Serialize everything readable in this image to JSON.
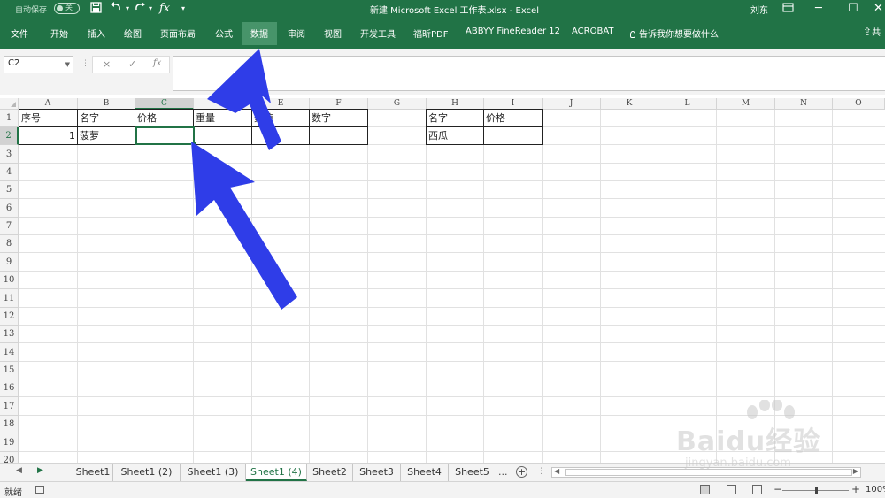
{
  "titlebar": {
    "autosave_label": "自动保存",
    "autosave_state": "关",
    "title": "新建 Microsoft Excel 工作表.xlsx  -  Excel",
    "user": "刘东",
    "icons": [
      "save-icon",
      "undo-icon",
      "redo-icon",
      "function-icon",
      "customize-icon",
      "ribbon-display-icon",
      "minimize-icon",
      "maximize-icon",
      "close-icon"
    ]
  },
  "ribbon": {
    "tabs": [
      "文件",
      "开始",
      "插入",
      "绘图",
      "页面布局",
      "公式",
      "数据",
      "审阅",
      "视图",
      "开发工具",
      "福昕PDF",
      "ABBYY FineReader 12",
      "ACROBAT",
      "告诉我你想要做什么",
      "共"
    ],
    "active_tab": "数据"
  },
  "formula_bar": {
    "name_box": "C2",
    "cancel_icon": "×",
    "enter_icon": "✓",
    "fx_label": "fx",
    "value": ""
  },
  "grid": {
    "columns": [
      "A",
      "B",
      "C",
      "D",
      "E",
      "F",
      "G",
      "H",
      "I",
      "J",
      "K",
      "L",
      "M",
      "N",
      "O"
    ],
    "rows": [
      "1",
      "2",
      "3",
      "4",
      "5",
      "6",
      "7",
      "8",
      "9",
      "10",
      "11",
      "12",
      "13",
      "14",
      "15",
      "16",
      "17",
      "18",
      "19",
      "20"
    ],
    "selected_column": "C",
    "selected_row": "2",
    "table1": {
      "headers": [
        "序号",
        "名字",
        "价格",
        "重量",
        "数值",
        "数字"
      ],
      "row2": [
        "1",
        "菠萝",
        "",
        "",
        "",
        ""
      ]
    },
    "table2": {
      "headers": [
        "名字",
        "价格"
      ],
      "row2": [
        "西瓜",
        ""
      ]
    }
  },
  "sheets": {
    "tabs": [
      "Sheet1",
      "Sheet1 (2)",
      "Sheet1 (3)",
      "Sheet1 (4)",
      "Sheet2",
      "Sheet3",
      "Sheet4",
      "Sheet5"
    ],
    "active": "Sheet1 (4)",
    "more_label": "...",
    "add_label": "+"
  },
  "status": {
    "ready": "就绪",
    "zoom": "100%"
  },
  "watermark": {
    "brand": "Baidu经验",
    "url": "jingyan.baidu.com"
  },
  "colors": {
    "excel_green": "#217346",
    "annotation_arrow": "#2f3de8"
  }
}
